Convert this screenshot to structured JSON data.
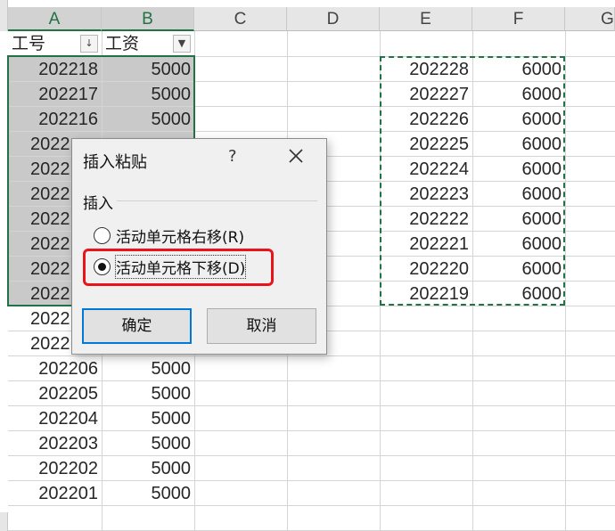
{
  "columns": [
    "A",
    "B",
    "C",
    "D",
    "E",
    "F",
    "G"
  ],
  "header_row": {
    "col_a": "工号",
    "col_a_filter": "↓",
    "col_b": "工资",
    "col_b_filter": "▼"
  },
  "left_rows": [
    {
      "id": "202218",
      "salary": "5000"
    },
    {
      "id": "202217",
      "salary": "5000"
    },
    {
      "id": "202216",
      "salary": "5000"
    },
    {
      "id": "2022",
      "salary": ""
    },
    {
      "id": "2022",
      "salary": ""
    },
    {
      "id": "2022",
      "salary": ""
    },
    {
      "id": "2022",
      "salary": ""
    },
    {
      "id": "2022",
      "salary": ""
    },
    {
      "id": "2022",
      "salary": ""
    },
    {
      "id": "2022",
      "salary": ""
    },
    {
      "id": "2022",
      "salary": ""
    },
    {
      "id": "2022",
      "salary": ""
    },
    {
      "id": "202206",
      "salary": "5000"
    },
    {
      "id": "202205",
      "salary": "5000"
    },
    {
      "id": "202204",
      "salary": "5000"
    },
    {
      "id": "202203",
      "salary": "5000"
    },
    {
      "id": "202202",
      "salary": "5000"
    },
    {
      "id": "202201",
      "salary": "5000"
    }
  ],
  "right_rows": [
    {
      "id": "202228",
      "salary": "6000"
    },
    {
      "id": "202227",
      "salary": "6000"
    },
    {
      "id": "202226",
      "salary": "6000"
    },
    {
      "id": "202225",
      "salary": "6000"
    },
    {
      "id": "202224",
      "salary": "6000"
    },
    {
      "id": "202223",
      "salary": "6000"
    },
    {
      "id": "202222",
      "salary": "6000"
    },
    {
      "id": "202221",
      "salary": "6000"
    },
    {
      "id": "202220",
      "salary": "6000"
    },
    {
      "id": "202219",
      "salary": "6000"
    }
  ],
  "dialog": {
    "title": "插入粘贴",
    "help": "?",
    "close_icon": "close-icon",
    "group_label": "插入",
    "option_right": "活动单元格右移(R)",
    "option_down": "活动单元格下移(D)",
    "selected_option": "option_down",
    "ok_label": "确定",
    "cancel_label": "取消"
  },
  "colors": {
    "excel_green": "#217346",
    "highlight_red": "#e8141a",
    "selection_shade": "#c9c9c9",
    "focus_blue": "#0078d7"
  }
}
